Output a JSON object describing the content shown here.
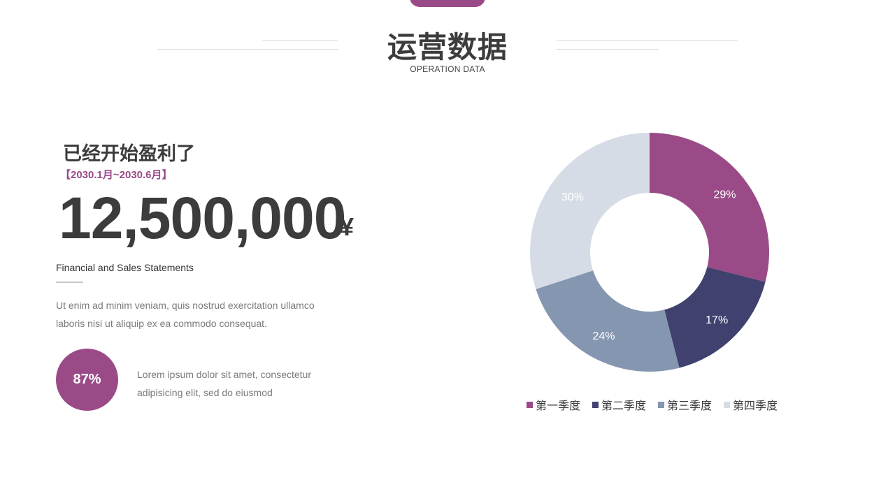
{
  "header": {
    "title": "运营数据",
    "subtitle": "OPERATION DATA"
  },
  "left": {
    "headline": "已经开始盈利了",
    "date_range": "【2030.1月~2030.6月】",
    "amount": "12,500,000",
    "currency": "¥",
    "statement_label": "Financial and Sales Statements",
    "body_line1": "Ut enim ad minim veniam, quis nostrud exercitation ullamco",
    "body_line2": "laboris nisi ut aliquip ex ea commodo consequat.",
    "badge_percent": "87%",
    "badge_text_line1": "Lorem ipsum dolor sit amet, consectetur",
    "badge_text_line2": "adipisicing elit, sed do eiusmod"
  },
  "colors": {
    "accent": "#9a4b87",
    "text_dark": "#3c3c3c",
    "text_gray": "#7a7a7a"
  },
  "chart_data": {
    "type": "pie",
    "donut": true,
    "title": "",
    "labels": [
      "第一季度",
      "第二季度",
      "第三季度",
      "第四季度"
    ],
    "values": [
      29,
      17,
      24,
      30
    ],
    "value_labels": [
      "29%",
      "17%",
      "24%",
      "30%"
    ],
    "colors": [
      "#9a4b87",
      "#40416e",
      "#8596b0",
      "#d6dce6"
    ],
    "legend_position": "bottom"
  }
}
